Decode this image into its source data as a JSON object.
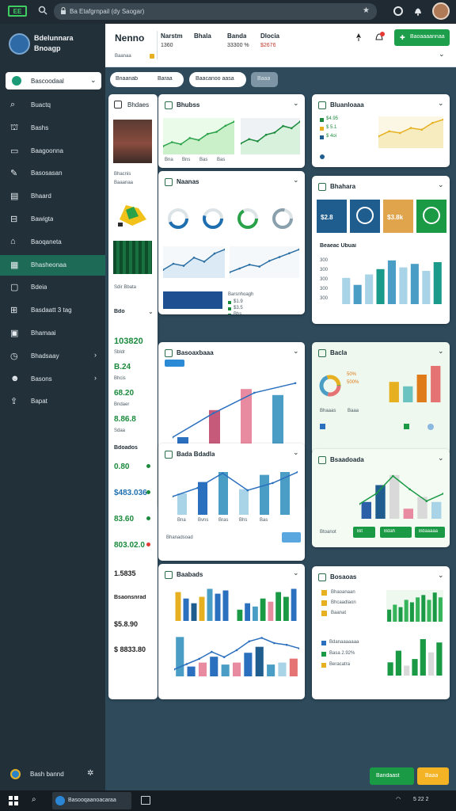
{
  "browser": {
    "logo": "EE",
    "url": "Ba Etafgrnpail (dy Saogar)"
  },
  "sidebar": {
    "brand_line1": "Bdelunnara",
    "brand_line2": "Bnoagp",
    "dropdown": "Bascoodaal",
    "items": [
      {
        "label": "Buactq",
        "icon": "search-icon"
      },
      {
        "label": "Bashs",
        "icon": "tree-icon"
      },
      {
        "label": "Baagoonna",
        "icon": "window-icon"
      },
      {
        "label": "Basosasan",
        "icon": "note-icon"
      },
      {
        "label": "Bhaard",
        "icon": "card-icon"
      },
      {
        "label": "Bawigta",
        "icon": "inbox-icon"
      },
      {
        "label": "Baoqaneta",
        "icon": "bank-icon"
      },
      {
        "label": "Bhasheonaa",
        "icon": "page-icon"
      },
      {
        "label": "Bdeia",
        "icon": "doc-icon"
      },
      {
        "label": "Basdaatt 3 tag",
        "icon": "table-icon"
      },
      {
        "label": "Bhamaai",
        "icon": "calendar-icon"
      },
      {
        "label": "Bhadsaay",
        "icon": "clock-icon"
      },
      {
        "label": "Basons",
        "icon": "users-icon"
      },
      {
        "label": "Bapat",
        "icon": "export-icon"
      }
    ],
    "user": "Bash bannd"
  },
  "header": {
    "title": "Nenno",
    "subtitle": "Baanaa",
    "stats": [
      {
        "label": "Narstm",
        "value": "1360"
      },
      {
        "label": "Bhala",
        "value": ""
      },
      {
        "label": "Banda",
        "value": "33300 %"
      },
      {
        "label": "Dlocia",
        "value": "$2676"
      }
    ],
    "action": "Baoaaaannaa"
  },
  "filters": {
    "chip1": "Bnaanab",
    "chip2": "Baraa",
    "chip3": "Baacanoo aasa",
    "chip4": "Baaa"
  },
  "left_panel": {
    "title": "Bhdaes",
    "caption1": "Bhacnis",
    "caption2": "Baaanaa",
    "caption3": "Sdir Bbata",
    "metrics_label": "Bdo",
    "kpis": [
      "103820",
      "B.24",
      "68.20",
      "8.86.8"
    ],
    "section": "Bdoados",
    "kpis2": [
      "0.80",
      "$483.036",
      "83.60",
      "803.02.0",
      "",
      ""
    ],
    "small": [
      "Sbldr",
      "Bhcis",
      "Bndaer",
      "Sdaa"
    ],
    "kpis3": [
      "1.5835",
      "Bsaonsnrad",
      "$5.8.90",
      "$ 8833.80"
    ]
  },
  "cards": {
    "c1": {
      "title": "Bhubss"
    },
    "c2": {
      "title": "Bluanloaaa",
      "legend": [
        "$4.95",
        "$ 5.1",
        "$ 4oi"
      ]
    },
    "c3": {
      "title": "Naanas",
      "caption": "Barsnhoagh",
      "legend": [
        "$1.9",
        "$3.5",
        "Bhs"
      ]
    },
    "c4": {
      "title": "Bhahara",
      "tiles": [
        "$2.8",
        "$3.8k"
      ],
      "tiles_label": "Bacaa",
      "subtitle": "Beaeac Ubuai",
      "subtitle2": "Beaoan",
      "yticks": [
        "300",
        "300",
        "300",
        "300",
        "300"
      ]
    },
    "c5": {
      "title": "Basoaxbaaa",
      "tag": "Baastaa",
      "link": "Bhaat"
    },
    "c6": {
      "title": "Bacla",
      "donut": [
        "50%",
        "500%"
      ],
      "legend": [
        "Bhaaas",
        "Baaa"
      ]
    },
    "c7": {
      "title": "Bada Bdadla",
      "footer": "Bhanadsoad",
      "btn1": "Bat",
      "btn2": "Bdhaasaanaag"
    },
    "c8": {
      "title": "Bsaadoada",
      "footer": "Btoanot",
      "btn1": "Bit",
      "btn2": "Bdah",
      "btn3": "Bdaaaaa"
    },
    "c9": {
      "title": "Baabads"
    },
    "c10": {
      "title": "Bosaoas",
      "legend": [
        "Bhaoanaan",
        "Bhcaadlaon",
        "Baanat"
      ],
      "legend2": [
        "Bdanaaaaaaa",
        "Basa 2.92%",
        "Beracatra"
      ]
    }
  },
  "chart_data": [
    {
      "type": "bar",
      "title": "",
      "categories": [
        "Bna",
        "Baas",
        "Bvas",
        "Bas"
      ],
      "values": [
        20,
        38,
        52,
        48
      ],
      "series_line": [
        25,
        45,
        62,
        70
      ]
    },
    {
      "type": "bar",
      "title": "",
      "categories": [
        "Bna",
        "Bvns",
        "Bras",
        "Bhs",
        "Bas"
      ],
      "values": [
        30,
        46,
        60,
        36,
        56,
        60
      ],
      "series_line": [
        30,
        44,
        68,
        40,
        52,
        70
      ]
    }
  ],
  "footer": {
    "btn_primary": "Bandaast",
    "btn_secondary": "Baaa"
  },
  "taskbar": {
    "app": "Basooqaanoacaraa",
    "time": "5 22 2"
  },
  "colors": {
    "accent": "#1a9a46",
    "navy": "#1f5d8f",
    "teal": "#4a9dc5",
    "pink": "#e57373",
    "gold": "#e6b020"
  }
}
